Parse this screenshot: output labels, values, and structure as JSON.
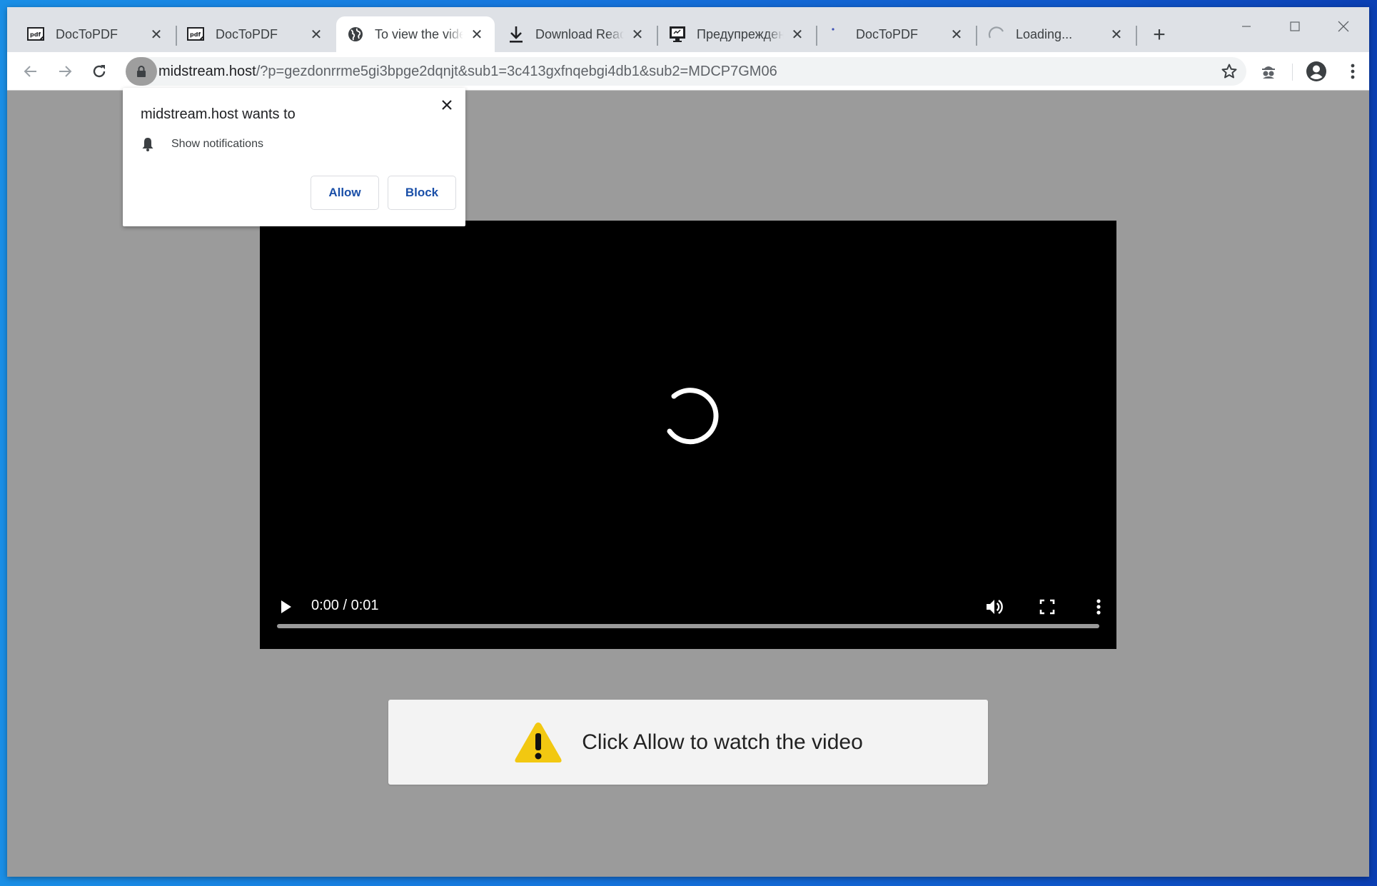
{
  "browser": {
    "tabs": [
      {
        "title": "DocToPDF",
        "icon": "pdf-icon",
        "active": false
      },
      {
        "title": "DocToPDF",
        "icon": "pdf-icon",
        "active": false
      },
      {
        "title": "To view the video",
        "icon": "globe-icon",
        "active": true
      },
      {
        "title": "Download Ready",
        "icon": "download-icon",
        "active": false
      },
      {
        "title": "Предупреждение",
        "icon": "monitor-icon",
        "active": false
      },
      {
        "title": "DocToPDF",
        "icon": "dot-loading-icon",
        "active": false
      },
      {
        "title": "Loading...",
        "icon": "spinner-icon",
        "active": false
      }
    ],
    "new_tab_symbol": "+",
    "url": {
      "host": "midstream.host",
      "path": "/?p=gezdonrrme5gi3bpge2dqnjt&sub1=3c413gxfnqebgi4db1&sub2=MDCP7GM06"
    }
  },
  "permission_prompt": {
    "title": "midstream.host wants to",
    "permission": "Show notifications",
    "allow_label": "Allow",
    "block_label": "Block"
  },
  "video": {
    "timecode": "0:00 / 0:01",
    "progress": 0
  },
  "warning": {
    "text": "Click Allow to watch the video",
    "icon_color": "#f2c811"
  }
}
